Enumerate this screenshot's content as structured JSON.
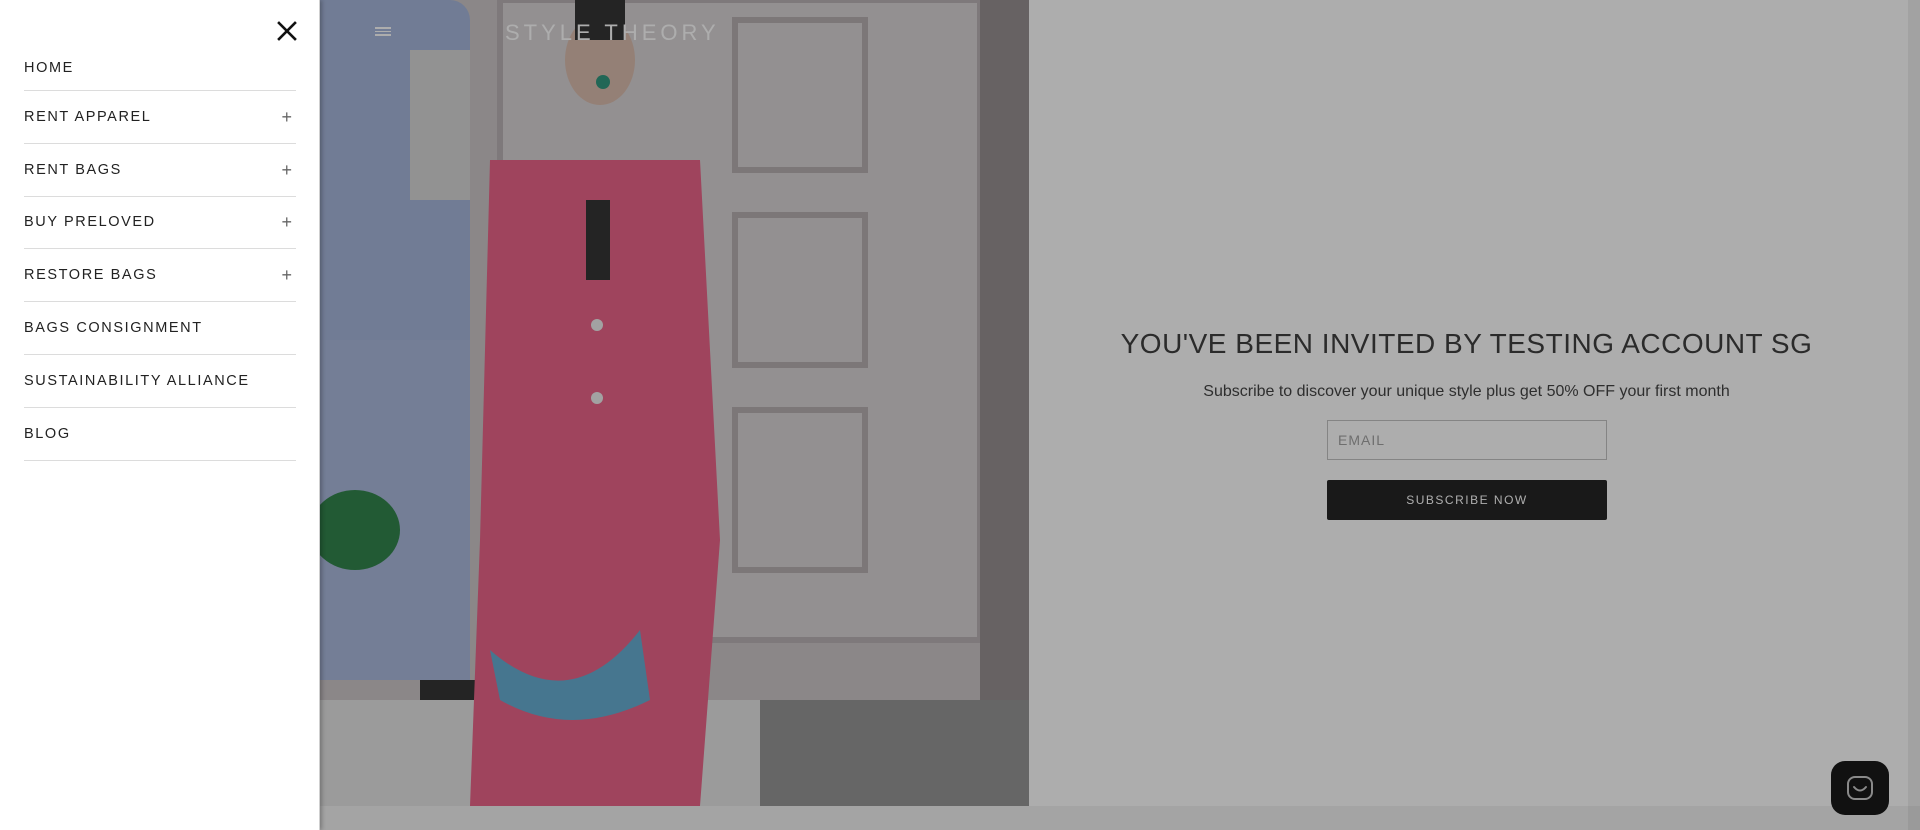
{
  "header": {
    "brand": "STYLE THEORY"
  },
  "drawer": {
    "close_icon": "close-icon",
    "items": [
      {
        "label": "HOME",
        "expandable": false
      },
      {
        "label": "RENT APPAREL",
        "expandable": true
      },
      {
        "label": "RENT BAGS",
        "expandable": true
      },
      {
        "label": "BUY PRELOVED",
        "expandable": true
      },
      {
        "label": "RESTORE BAGS",
        "expandable": true
      },
      {
        "label": "BAGS CONSIGNMENT",
        "expandable": false
      },
      {
        "label": "SUSTAINABILITY ALLIANCE",
        "expandable": false
      },
      {
        "label": "BLOG",
        "expandable": false
      }
    ],
    "expand_symbol": "+"
  },
  "hero": {
    "title": "YOU'VE BEEN INVITED BY TESTING ACCOUNT SG",
    "subtitle": "Subscribe to discover your unique style plus get 50% OFF your first month",
    "email_placeholder": "EMAIL",
    "email_value": "",
    "subscribe_label": "SUBSCRIBE NOW"
  },
  "chat": {
    "icon": "chat-smile-icon"
  },
  "colors": {
    "overlay": "#282828",
    "button": "#111111",
    "suit_pink": "#e8567e",
    "suit_blue": "#9fb1d8",
    "bag_blue": "#5aa6cf",
    "bag_green": "#1f7a3c"
  }
}
